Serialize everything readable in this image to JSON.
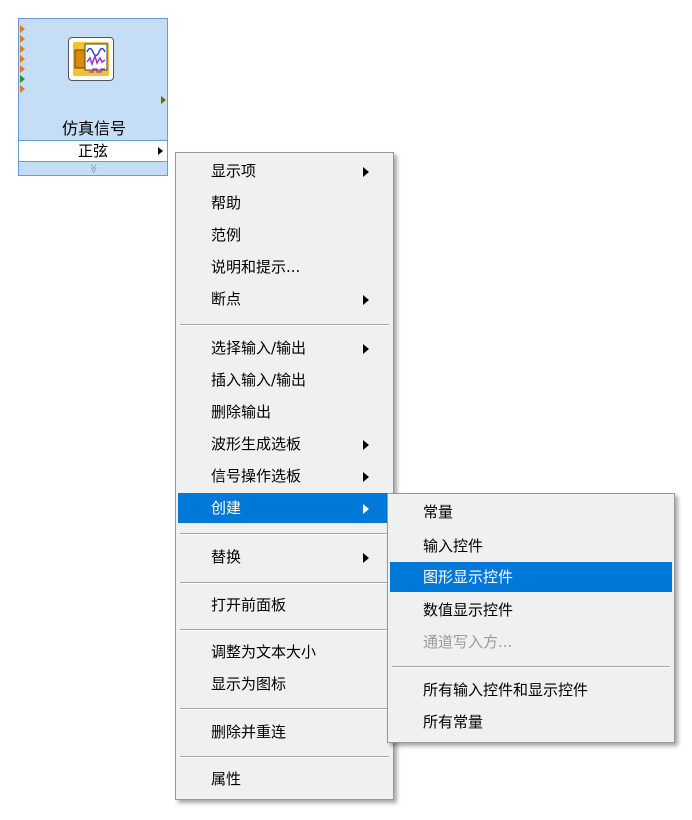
{
  "node": {
    "title": "仿真信号",
    "selector_value": "正弦",
    "expand_glyph": "≫"
  },
  "context_menu": {
    "items": [
      {
        "label": "显示项",
        "submenu": true
      },
      {
        "label": "帮助"
      },
      {
        "label": "范例"
      },
      {
        "label": "说明和提示..."
      },
      {
        "label": "断点",
        "submenu": true
      },
      {
        "label": "选择输入/输出",
        "submenu": true
      },
      {
        "label": "插入输入/输出"
      },
      {
        "label": "删除输出"
      },
      {
        "label": "波形生成选板",
        "submenu": true
      },
      {
        "label": "信号操作选板",
        "submenu": true
      },
      {
        "label": "创建",
        "submenu": true,
        "highlighted": true
      },
      {
        "label": "替换",
        "submenu": true
      },
      {
        "label": "打开前面板"
      },
      {
        "label": "调整为文本大小"
      },
      {
        "label": "显示为图标"
      },
      {
        "label": "删除并重连"
      },
      {
        "label": "属性"
      }
    ]
  },
  "create_submenu": {
    "items": [
      {
        "label": "常量"
      },
      {
        "label": "输入控件"
      },
      {
        "label": "图形显示控件",
        "highlighted": true
      },
      {
        "label": "数值显示控件"
      },
      {
        "label": "通道写入方...",
        "disabled": true
      },
      {
        "label": "所有输入控件和显示控件"
      },
      {
        "label": "所有常量"
      }
    ]
  },
  "colors": {
    "highlight": "#0078d7",
    "node_fill": "#c5ddf5",
    "node_border": "#6b9bd2",
    "menu_bg": "#f0f0f0"
  }
}
